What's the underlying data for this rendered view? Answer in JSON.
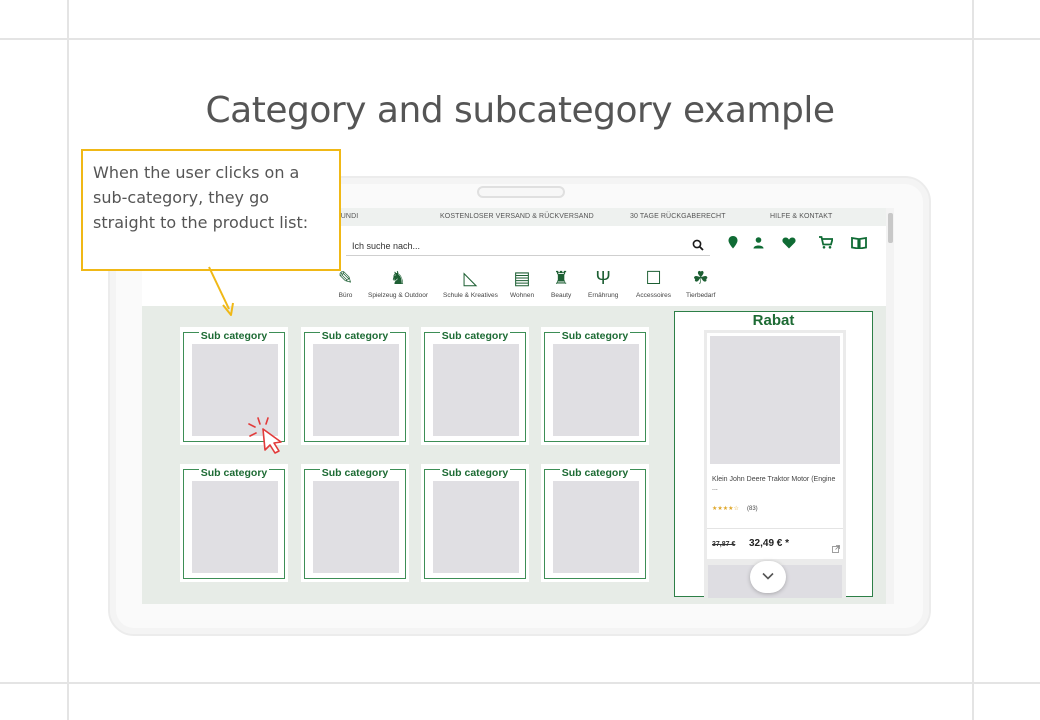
{
  "slide": {
    "title": "Category and subcategory example",
    "callout_text": "When the user clicks on a sub-category, they go straight to the product list:"
  },
  "site": {
    "topbar": {
      "left": "SUNDI",
      "shipping": "KOSTENLOSER VERSAND & RÜCKVERSAND",
      "returns": "30 TAGE RÜCKGABERECHT",
      "help": "HILFE & KONTAKT"
    },
    "search": {
      "placeholder": "Ich suche nach..."
    },
    "header_icons": [
      "location-icon",
      "account-icon",
      "wishlist-heart-icon",
      "cart-icon",
      "catalog-book-icon"
    ],
    "categories": [
      {
        "label": "Büro",
        "icon": "pencil-cup-icon",
        "glyph": "✎"
      },
      {
        "label": "Spielzeug & Outdoor",
        "icon": "rocking-horse-icon",
        "glyph": "♞"
      },
      {
        "label": "Schule & Kreatives",
        "icon": "set-square-icon",
        "glyph": "◺"
      },
      {
        "label": "Wohnen",
        "icon": "living-room-icon",
        "glyph": "▤"
      },
      {
        "label": "Beauty",
        "icon": "cosmetics-icon",
        "glyph": "♜"
      },
      {
        "label": "Ernährung",
        "icon": "fork-knife-icon",
        "glyph": "Ψ"
      },
      {
        "label": "Accessoires",
        "icon": "briefcase-icon",
        "glyph": "☐"
      },
      {
        "label": "Tierbedarf",
        "icon": "pets-icon",
        "glyph": "☘"
      }
    ],
    "subcategories": [
      {
        "label": "Sub category"
      },
      {
        "label": "Sub category"
      },
      {
        "label": "Sub category"
      },
      {
        "label": "Sub category"
      },
      {
        "label": "Sub category"
      },
      {
        "label": "Sub category"
      },
      {
        "label": "Sub category"
      },
      {
        "label": "Sub category"
      }
    ],
    "rabat": {
      "title": "Rabat",
      "product": {
        "name": "Klein John Deere Traktor Motor (Engine ...",
        "stars": "★★★★☆",
        "reviews": "(83)",
        "old_price": "37,87 €",
        "new_price": "32,49 € *"
      }
    }
  },
  "colors": {
    "brand_green": "#1d6b34",
    "callout_border": "#f0b816",
    "content_bg": "#e7ece7",
    "cursor_red": "#e23b3b"
  }
}
